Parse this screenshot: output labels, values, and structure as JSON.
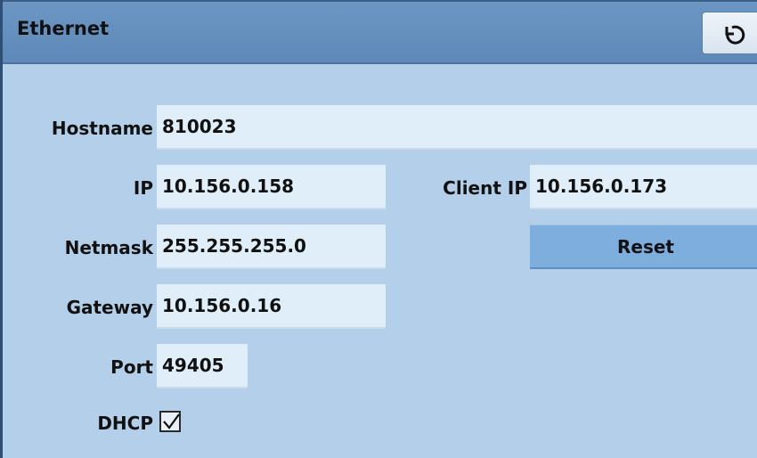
{
  "window": {
    "title": "Ethernet"
  },
  "icons": {
    "refresh": "refresh-icon",
    "checkmark": "checkmark-icon"
  },
  "form": {
    "hostname": {
      "label": "Hostname",
      "value": "810023"
    },
    "ip": {
      "label": "IP",
      "value": "10.156.0.158"
    },
    "client_ip": {
      "label": "Client IP",
      "value": "10.156.0.173"
    },
    "netmask": {
      "label": "Netmask",
      "value": "255.255.255.0"
    },
    "gateway": {
      "label": "Gateway",
      "value": "10.156.0.16"
    },
    "port": {
      "label": "Port",
      "value": "49405"
    },
    "dhcp": {
      "label": "DHCP",
      "checked": true
    },
    "reset_label": "Reset"
  },
  "colors": {
    "header": "#6c96c3",
    "background": "#b3cfe9",
    "field": "#dfeef8",
    "button": "#7eaedd"
  }
}
